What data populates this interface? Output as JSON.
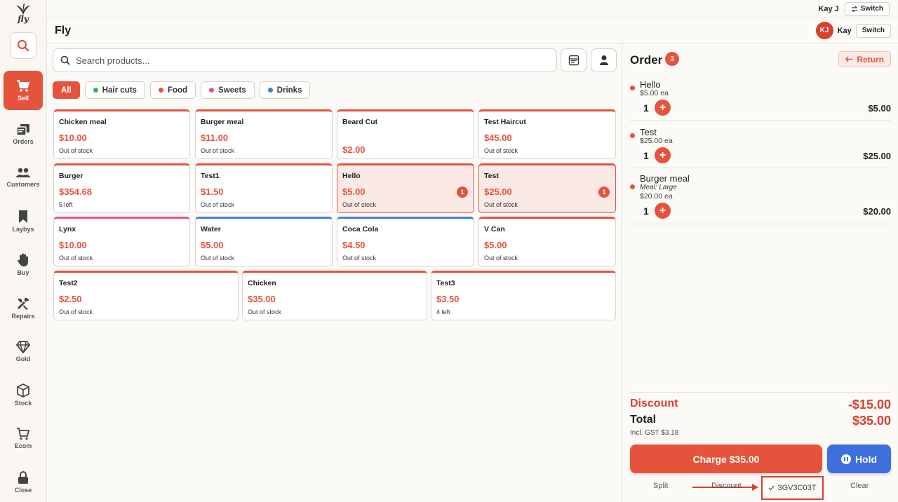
{
  "app": {
    "logo_text": "fly",
    "title": "Fly"
  },
  "header": {
    "user_name": "Kay J",
    "switch_label": "Switch",
    "avatar_initials": "KJ",
    "short_name": "Kay",
    "switch_label_2": "Switch"
  },
  "sidebar": {
    "items": [
      {
        "label": "Sell",
        "icon": "cart-icon",
        "active": true
      },
      {
        "label": "Orders",
        "icon": "orders-icon"
      },
      {
        "label": "Customers",
        "icon": "users-icon"
      },
      {
        "label": "Laybys",
        "icon": "bookmark-icon"
      },
      {
        "label": "Buy",
        "icon": "hand-icon"
      },
      {
        "label": "Repairs",
        "icon": "tools-icon"
      },
      {
        "label": "Gold",
        "icon": "diamond-icon"
      },
      {
        "label": "Stock",
        "icon": "box-icon"
      },
      {
        "label": "Ecom",
        "icon": "shopping-cart-icon"
      },
      {
        "label": "Close",
        "icon": "lock-icon"
      }
    ]
  },
  "search": {
    "placeholder": "Search products..."
  },
  "filters": [
    {
      "label": "All",
      "active": true
    },
    {
      "label": "Hair cuts",
      "color": "#3bb54a"
    },
    {
      "label": "Food",
      "color": "#e5533d"
    },
    {
      "label": "Sweets",
      "color": "#e0559a"
    },
    {
      "label": "Drinks",
      "color": "#3f7fd9"
    }
  ],
  "products": [
    {
      "name": "Chicken meal",
      "price": "$10.00",
      "stock": "Out of stock",
      "accent": "#e5533d"
    },
    {
      "name": "Burger meal",
      "price": "$11.00",
      "stock": "Out of stock",
      "accent": "#e5533d"
    },
    {
      "name": "Beard Cut",
      "price": "$2.00",
      "stock": "",
      "accent": "#e5533d"
    },
    {
      "name": "Test Haircut",
      "price": "$45.00",
      "stock": "Out of stock",
      "accent": "#e5533d"
    },
    {
      "name": "Burger",
      "price": "$354.68",
      "stock": "5 left",
      "accent": "#e5533d"
    },
    {
      "name": "Test1",
      "price": "$1.50",
      "stock": "Out of stock",
      "accent": "#e5533d"
    },
    {
      "name": "Hello",
      "price": "$5.00",
      "stock": "Out of stock",
      "accent": "#e5533d",
      "count": "1",
      "selected": true
    },
    {
      "name": "Test",
      "price": "$25.00",
      "stock": "Out of stock",
      "accent": "#e5533d",
      "count": "1",
      "selected": true
    },
    {
      "name": "Lynx",
      "price": "$10.00",
      "stock": "Out of stock",
      "accent": "#e0559a"
    },
    {
      "name": "Water",
      "price": "$5.00",
      "stock": "Out of stock",
      "accent": "#3f7fd9"
    },
    {
      "name": "Coca Cola",
      "price": "$4.50",
      "stock": "Out of stock",
      "accent": "#3f7fd9"
    },
    {
      "name": "V Can",
      "price": "$5.00",
      "stock": "Out of stock",
      "accent": "#e5533d"
    },
    {
      "name": "Test2",
      "price": "$2.50",
      "stock": "Out of stock",
      "accent": "#e5533d"
    },
    {
      "name": "Chicken",
      "price": "$35.00",
      "stock": "Out of stock",
      "accent": "#e5533d"
    },
    {
      "name": "Test3",
      "price": "$3.50",
      "stock": "4 left",
      "accent": "#e5533d"
    }
  ],
  "order": {
    "title": "Order",
    "count": "3",
    "return_label": "Return",
    "lines": [
      {
        "name": "Hello",
        "meta": "",
        "unit": "$5.00 ea",
        "qty": "1",
        "total": "$5.00"
      },
      {
        "name": "Test",
        "meta": "",
        "unit": "$25.00 ea",
        "qty": "1",
        "total": "$25.00"
      },
      {
        "name": "Burger meal",
        "meta": "Meal: Large",
        "unit": "$20.00 ea",
        "qty": "1",
        "total": "$20.00"
      }
    ],
    "plus_symbol": "+",
    "discount_label": "Discount",
    "discount_value": "-$15.00",
    "total_label": "Total",
    "total_value": "$35.00",
    "gst_text": "Incl. GST $3.18",
    "charge_label": "Charge $35.00",
    "hold_label": "Hold",
    "split_label": "Split",
    "discount_link": "Discount",
    "code_value": "3GV3C03T",
    "clear_label": "Clear"
  }
}
